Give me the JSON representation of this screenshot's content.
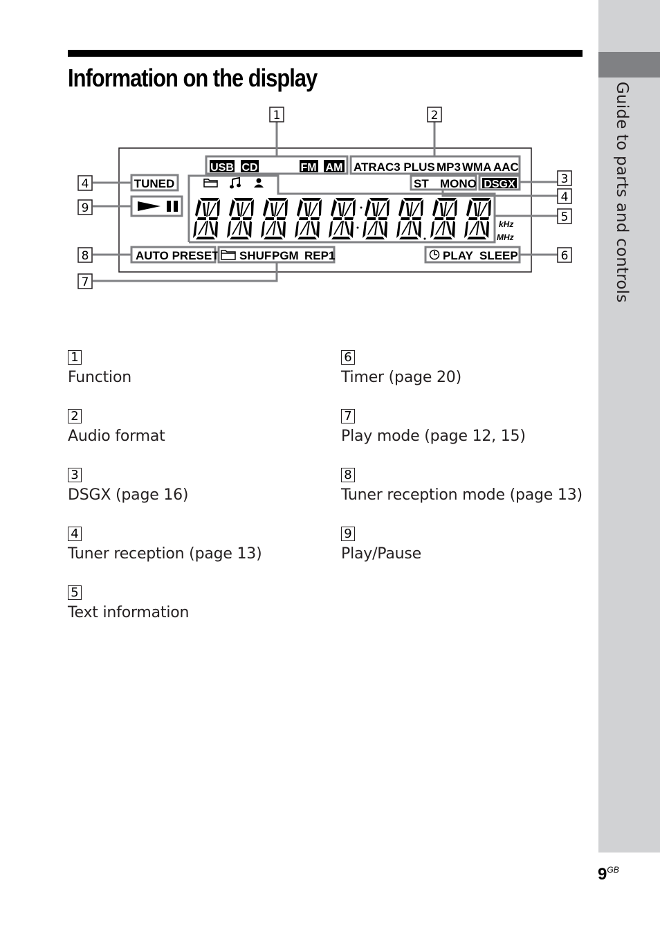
{
  "sidebar": {
    "section_label": "Guide to parts and controls"
  },
  "header": {
    "title": "Information on the display"
  },
  "display": {
    "function_indicators": [
      "USB",
      "CD",
      "FM",
      "AM"
    ],
    "format_indicators": [
      "ATRAC3 PLUS",
      "MP3",
      "WMA",
      "AAC"
    ],
    "tuned_label": "TUNED",
    "icons": [
      "folder-icon",
      "music-note-icon",
      "artist-icon"
    ],
    "reception_indicators": [
      "ST",
      "MONO"
    ],
    "dsgx_label": "DSGX",
    "play_pause_icons": [
      "play-icon",
      "pause-icon"
    ],
    "unit_labels": [
      "kHz",
      "MHz"
    ],
    "tuner_mode_label": "AUTO PRESET",
    "play_mode_indicators": [
      "SHUF",
      "PGM",
      "REP1"
    ],
    "timer_indicators": [
      "PLAY",
      "SLEEP"
    ],
    "callouts": [
      "1",
      "2",
      "3",
      "4",
      "4",
      "5",
      "6",
      "7",
      "8",
      "9"
    ]
  },
  "legend": [
    {
      "number": "1",
      "label": "Function"
    },
    {
      "number": "2",
      "label": "Audio format"
    },
    {
      "number": "3",
      "label": "DSGX (page 16)"
    },
    {
      "number": "4",
      "label": "Tuner reception (page 13)"
    },
    {
      "number": "5",
      "label": "Text information"
    },
    {
      "number": "6",
      "label": "Timer (page 20)"
    },
    {
      "number": "7",
      "label": "Play mode (page 12, 15)"
    },
    {
      "number": "8",
      "label": "Tuner reception mode (page 13)"
    },
    {
      "number": "9",
      "label": "Play/Pause"
    }
  ],
  "footer": {
    "page_number": "9",
    "region": "GB"
  }
}
